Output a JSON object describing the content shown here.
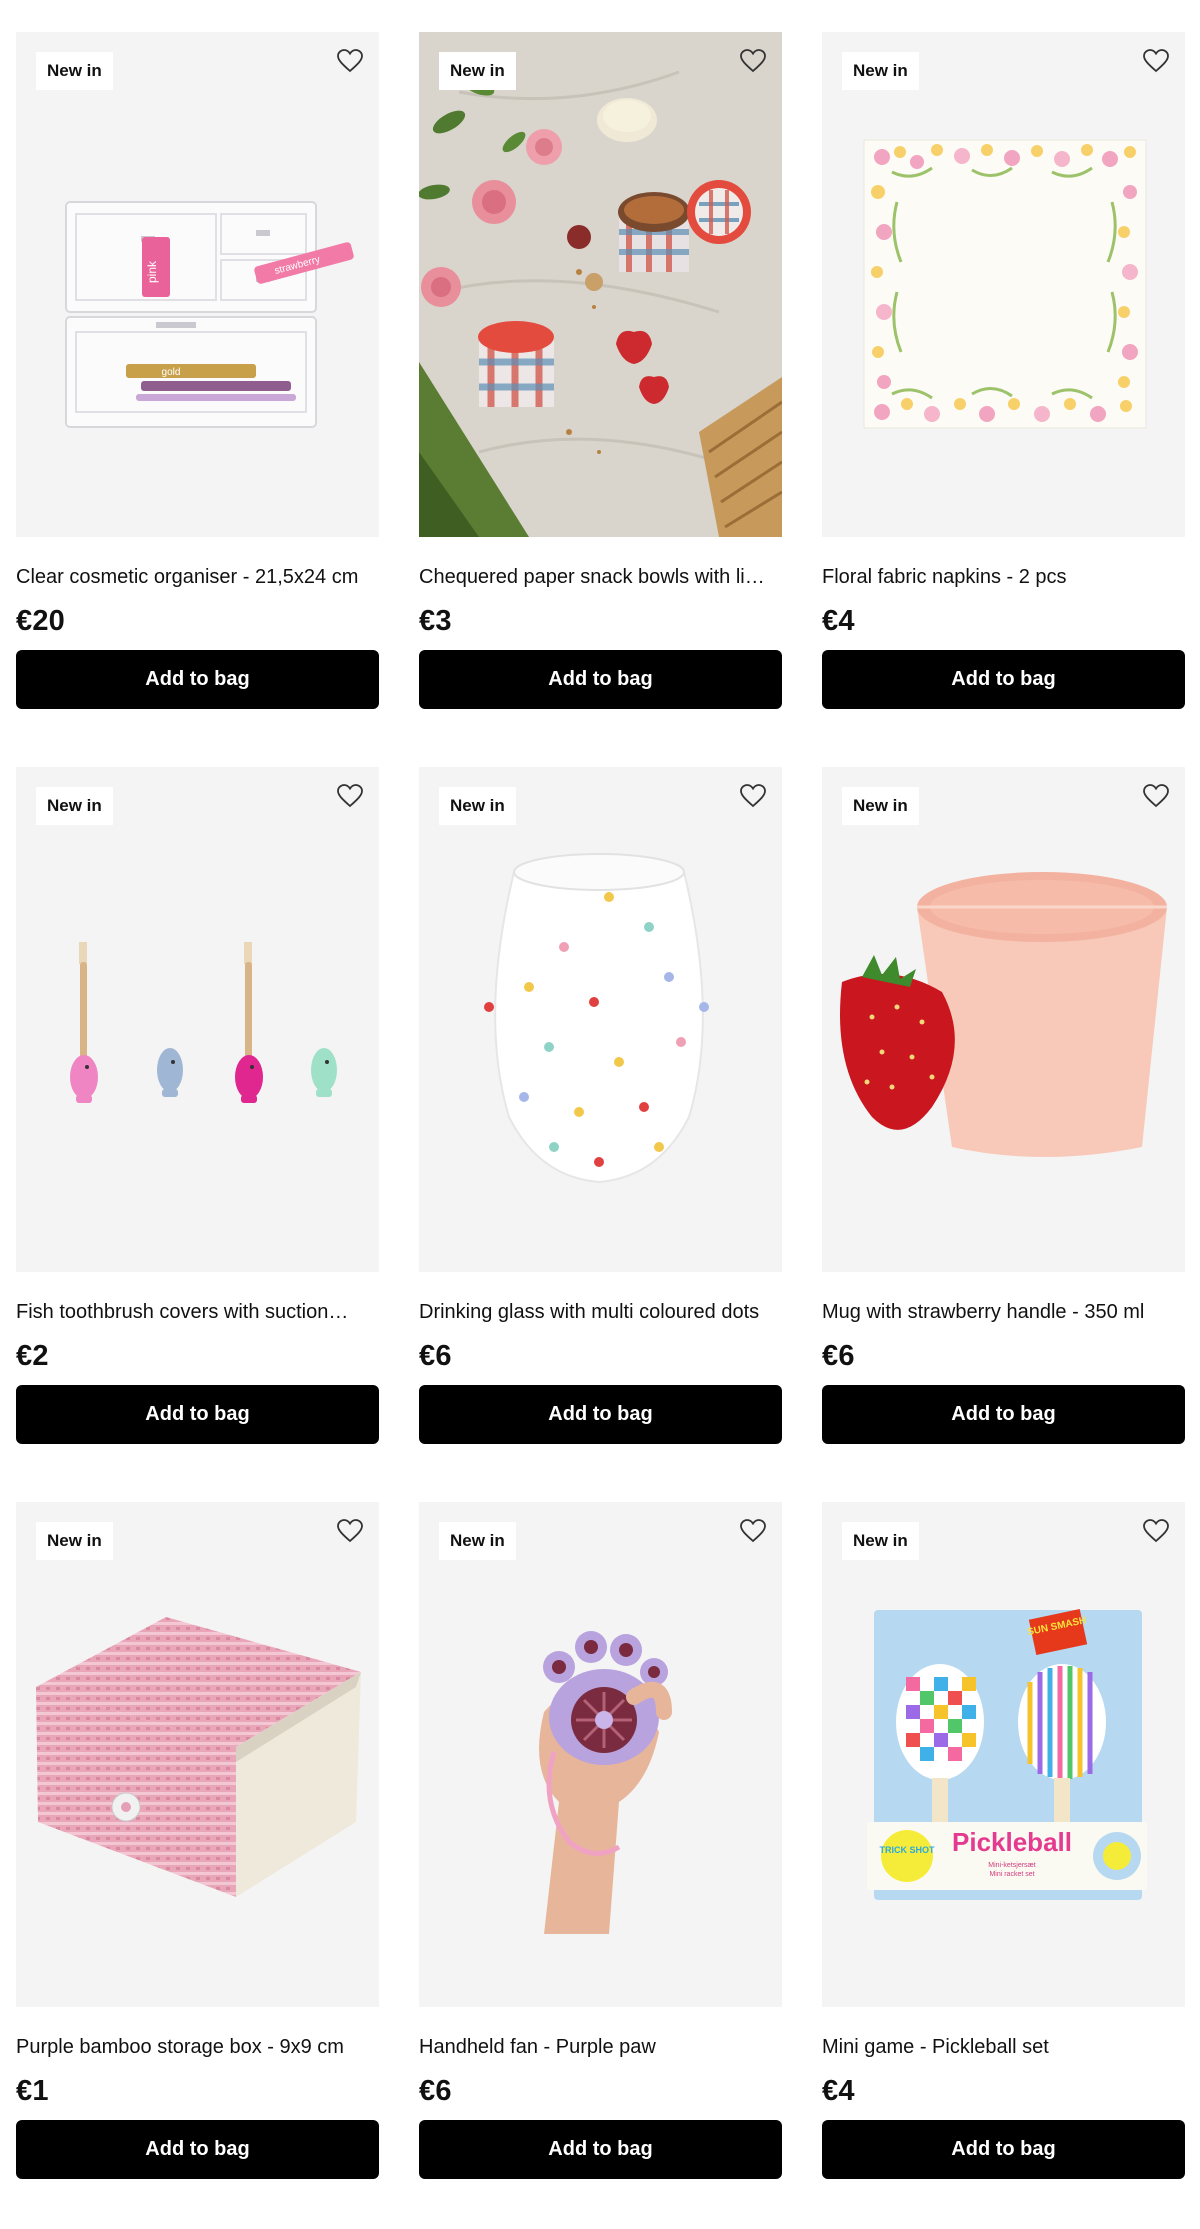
{
  "colors": {
    "button_bg": "#000000",
    "button_text": "#ffffff",
    "tile_bg": "#f4f4f4",
    "badge_bg": "#ffffff"
  },
  "products": [
    {
      "badge": "New in",
      "name": "Clear cosmetic organiser - 21,5x24 cm",
      "price": "€20",
      "button": "Add to bag",
      "wishlist_icon": "heart-outline-icon",
      "image_text": "pink",
      "image_text_2": "strawberry",
      "image_text_3": "gold"
    },
    {
      "badge": "New in",
      "name": "Chequered paper snack bowls with li…",
      "price": "€3",
      "button": "Add to bag",
      "wishlist_icon": "heart-outline-icon"
    },
    {
      "badge": "New in",
      "name": "Floral fabric napkins - 2 pcs",
      "price": "€4",
      "button": "Add to bag",
      "wishlist_icon": "heart-outline-icon"
    },
    {
      "badge": "New in",
      "name": "Fish toothbrush covers with suction…",
      "price": "€2",
      "button": "Add to bag",
      "wishlist_icon": "heart-outline-icon"
    },
    {
      "badge": "New in",
      "name": "Drinking glass with multi coloured dots",
      "price": "€6",
      "button": "Add to bag",
      "wishlist_icon": "heart-outline-icon"
    },
    {
      "badge": "New in",
      "name": "Mug with strawberry handle - 350 ml",
      "price": "€6",
      "button": "Add to bag",
      "wishlist_icon": "heart-outline-icon"
    },
    {
      "badge": "New in",
      "name": "Purple bamboo storage box - 9x9 cm",
      "price": "€1",
      "button": "Add to bag",
      "wishlist_icon": "heart-outline-icon"
    },
    {
      "badge": "New in",
      "name": "Handheld fan - Purple paw",
      "price": "€6",
      "button": "Add to bag",
      "wishlist_icon": "heart-outline-icon"
    },
    {
      "badge": "New in",
      "name": "Mini game - Pickleball set",
      "price": "€4",
      "button": "Add to bag",
      "wishlist_icon": "heart-outline-icon",
      "image_text": "Pickleball",
      "image_text_2": "SUN SMASH",
      "image_text_3": "TRICK SHOT",
      "image_text_4": "Mini-ketsjersæt",
      "image_text_5": "Mini racket set"
    }
  ]
}
